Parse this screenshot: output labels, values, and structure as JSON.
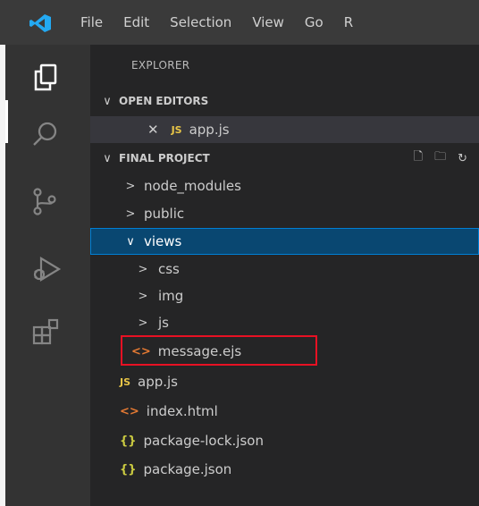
{
  "menu": [
    "File",
    "Edit",
    "Selection",
    "View",
    "Go",
    "R"
  ],
  "activity_bar": [
    "explorer-icon",
    "search-icon",
    "source-control-icon",
    "run-debug-icon",
    "extensions-icon"
  ],
  "sidebar": {
    "title": "EXPLORER",
    "open_editors": {
      "title": "OPEN EDITORS",
      "files": [
        {
          "icon": "JS",
          "name": "app.js"
        }
      ]
    },
    "project": {
      "title": "FINAL PROJECT",
      "tree": [
        {
          "type": "folder",
          "name": "node_modules",
          "expanded": false
        },
        {
          "type": "folder",
          "name": "public",
          "expanded": false
        },
        {
          "type": "folder",
          "name": "views",
          "expanded": true,
          "selected": true
        },
        {
          "type": "folder",
          "name": "css",
          "expanded": false
        },
        {
          "type": "folder",
          "name": "img",
          "expanded": false
        },
        {
          "type": "folder",
          "name": "js",
          "expanded": false
        },
        {
          "type": "file",
          "icon": "<>",
          "name": "message.ejs",
          "highlighted": true
        },
        {
          "type": "file",
          "icon": "JS",
          "name": "app.js"
        },
        {
          "type": "file",
          "icon": "<>",
          "name": "index.html"
        },
        {
          "type": "file",
          "icon": "{}",
          "name": "package-lock.json"
        },
        {
          "type": "file",
          "icon": "{}",
          "name": "package.json"
        }
      ]
    }
  },
  "colors": {
    "selection": "#094771",
    "highlight_border": "#e81123",
    "js_icon": "#e8c547",
    "html_icon": "#e37933",
    "json_icon": "#cbcb41"
  }
}
